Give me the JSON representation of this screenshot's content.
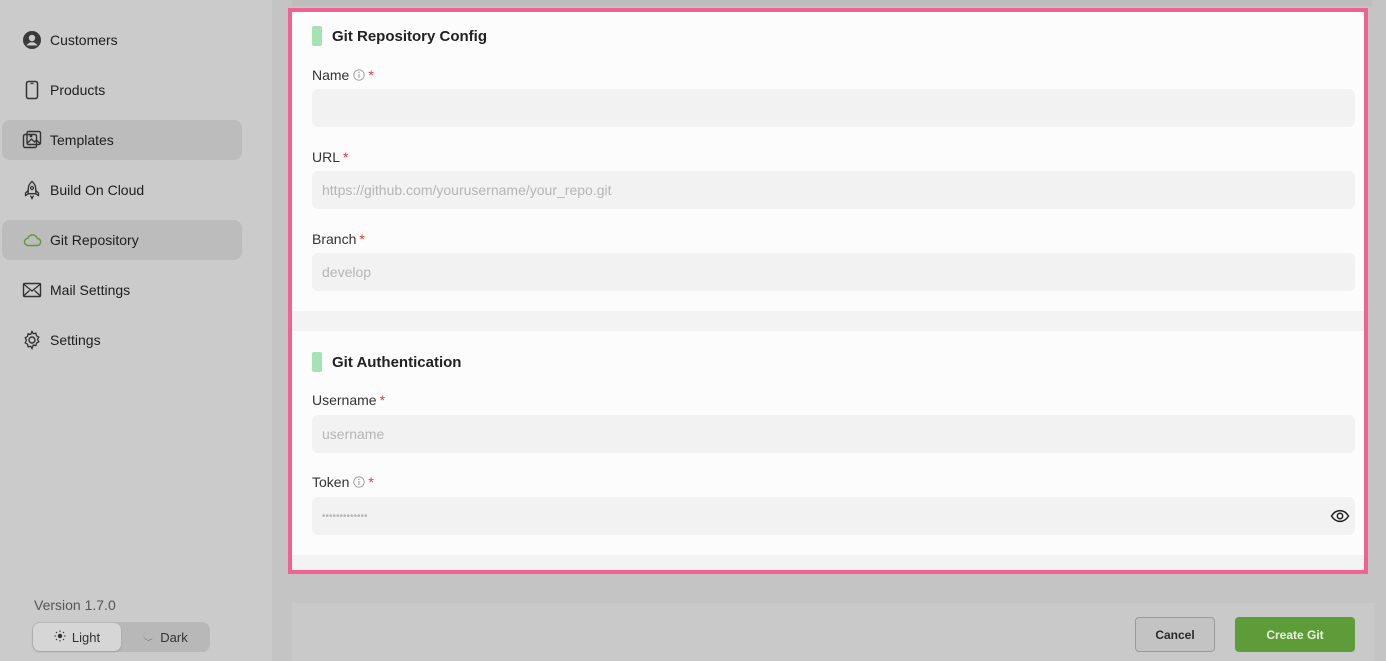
{
  "sidebar": {
    "items": [
      {
        "label": "Customers",
        "icon": "user-circle-icon",
        "active": false
      },
      {
        "label": "Products",
        "icon": "phone-icon",
        "active": false
      },
      {
        "label": "Templates",
        "icon": "image-icon",
        "active": true
      },
      {
        "label": "Build On Cloud",
        "icon": "rocket-icon",
        "active": false
      },
      {
        "label": "Git Repository",
        "icon": "cloud-icon",
        "active": true
      },
      {
        "label": "Mail Settings",
        "icon": "mail-icon",
        "active": false
      },
      {
        "label": "Settings",
        "icon": "gear-icon",
        "active": false
      }
    ],
    "version": "Version 1.7.0",
    "theme": {
      "light_label": "Light",
      "dark_label": "Dark",
      "selected": "Light"
    }
  },
  "form": {
    "repo_section": {
      "title": "Git Repository Config",
      "name_label": "Name",
      "name_value": "",
      "url_label": "URL",
      "url_placeholder": "https://github.com/yourusername/your_repo.git",
      "branch_label": "Branch",
      "branch_placeholder": "develop"
    },
    "auth_section": {
      "title": "Git Authentication",
      "username_label": "Username",
      "username_placeholder": "username",
      "token_label": "Token",
      "token_placeholder": "•••••••••••••"
    },
    "required_mark": "*"
  },
  "footer": {
    "cancel_label": "Cancel",
    "create_label": "Create Git"
  },
  "colors": {
    "accent_green": "#5e9c3a",
    "section_bar": "#a6e3b4",
    "highlight_border": "#f06292",
    "required": "#e53935"
  }
}
